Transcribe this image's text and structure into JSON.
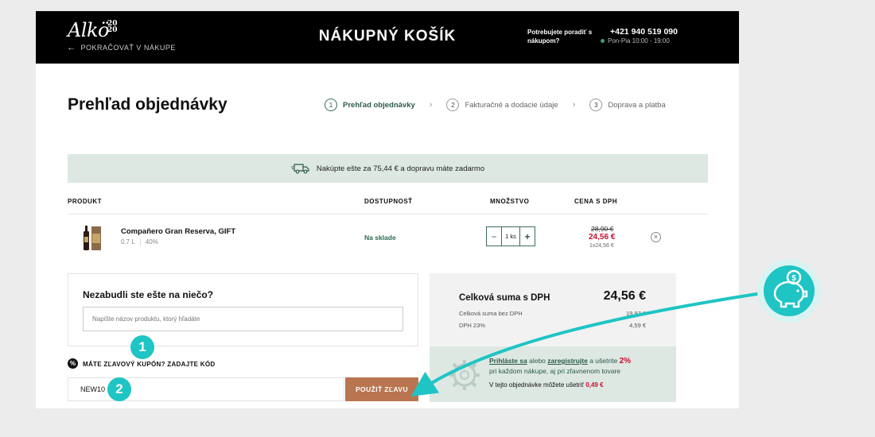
{
  "header": {
    "logo": "Alkö",
    "logo_sup": "20\n20",
    "back_label": "POKRAČOVAŤ V NÁKUPE",
    "title": "NÁKUPNÝ KOŠÍK",
    "help_text": "Potrebujete poradiť s nákupom?",
    "phone": "+421 940 519 090",
    "hours": "Pon-Pia 10:00 - 19:00"
  },
  "page_title": "Prehľad objednávky",
  "steps": [
    {
      "num": "1",
      "label": "Prehľad objednávky"
    },
    {
      "num": "2",
      "label": "Fakturačné a dodacie údaje"
    },
    {
      "num": "3",
      "label": "Doprava a platba"
    }
  ],
  "banner": "Nakúpte ešte za 75,44 € a dopravu máte zadarmo",
  "table_headers": {
    "product": "PRODUKT",
    "availability": "DOSTUPNOSŤ",
    "quantity": "MNOŽSTVO",
    "price": "CENA S DPH"
  },
  "item": {
    "name": "Compañero Gran Reserva, GIFT",
    "volume": "0.7 L",
    "abv": "40%",
    "availability": "Na sklade",
    "qty": "1 ks",
    "old_price": "28,90 €",
    "price": "24,56 €",
    "unit_price": "1x24,56 €"
  },
  "forgot": {
    "title": "Nezabudli ste ešte na niečo?",
    "placeholder": "Napíšte názov produktu, ktorý hľadáte"
  },
  "coupon": {
    "label": "MÁTE ZĽAVOVÝ KUPÓN? ZADAJTE KÓD",
    "value": "NEW10",
    "apply_label": "POUŽIŤ ZĽAVU"
  },
  "summary": {
    "total_label": "Celková suma s DPH",
    "total_value": "24,56 €",
    "net_label": "Celková suma bez DPH",
    "net_value": "19,97 €",
    "vat_label": "DPH 23%",
    "vat_value": "4,59 €"
  },
  "promo": {
    "login": "Prihláste sa",
    "or": "alebo",
    "register": "zaregistrujte",
    "save_text": "a ušetrite",
    "percent": "2%",
    "line2": "pri každom nákupe, aj pri zľavnenom tovare",
    "order_save": "V tejto objednávke môžete ušetriť",
    "order_save_value": "0,49 €"
  },
  "annotations": {
    "badge1": "1",
    "badge2": "2"
  },
  "colors": {
    "accent_green": "#2b5a49",
    "brand_bronze": "#b9754f",
    "sale_red": "#c8102e",
    "teal_overlay": "#1fc4c4"
  }
}
